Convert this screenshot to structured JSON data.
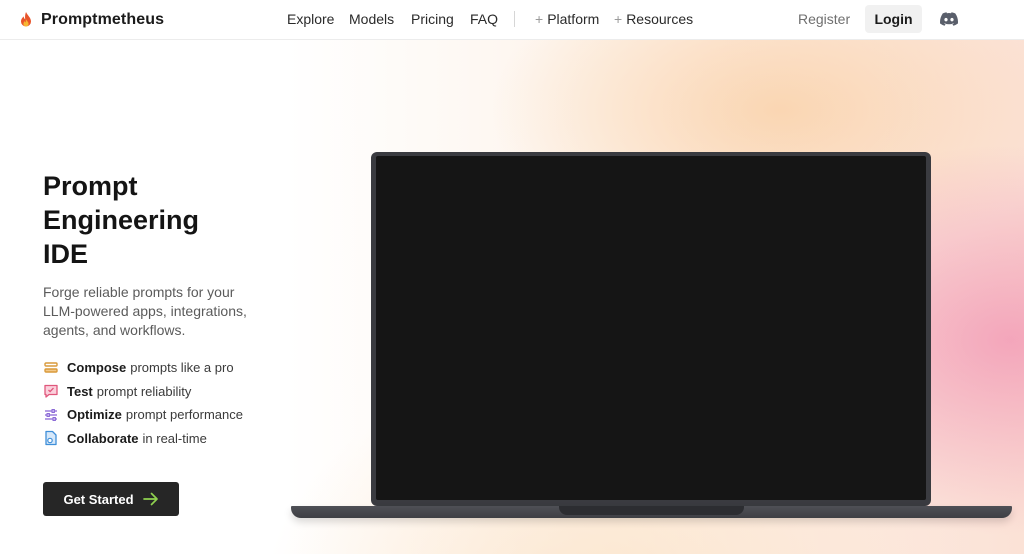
{
  "header": {
    "brand": "Promptmetheus",
    "logo_icon": "flame-icon",
    "nav": [
      "Explore",
      "Models",
      "Pricing",
      "FAQ"
    ],
    "dropdowns": [
      {
        "prefix": "+",
        "label": "Platform"
      },
      {
        "prefix": "+",
        "label": "Resources"
      }
    ],
    "register": "Register",
    "login": "Login",
    "discord_icon": "discord-icon"
  },
  "hero": {
    "headline": [
      "Prompt",
      "Engineering",
      "IDE"
    ],
    "subtitle": "Forge reliable prompts for your LLM-powered apps, integrations, agents, and workflows.",
    "features": [
      {
        "icon": "stack-icon",
        "bold": "Compose",
        "rest": "prompts like a pro",
        "color": "#d99a3b"
      },
      {
        "icon": "chat-test-icon",
        "bold": "Test",
        "rest": "prompt reliability",
        "color": "#e0577c"
      },
      {
        "icon": "sliders-icon",
        "bold": "Optimize",
        "rest": "prompt performance",
        "color": "#8b6ad6"
      },
      {
        "icon": "document-share-icon",
        "bold": "Collaborate",
        "rest": "in real-time",
        "color": "#3f8fd9"
      }
    ],
    "cta": "Get Started",
    "cta_icon": "arrow-right-icon",
    "cta_arrow_color": "#8fd14f"
  }
}
